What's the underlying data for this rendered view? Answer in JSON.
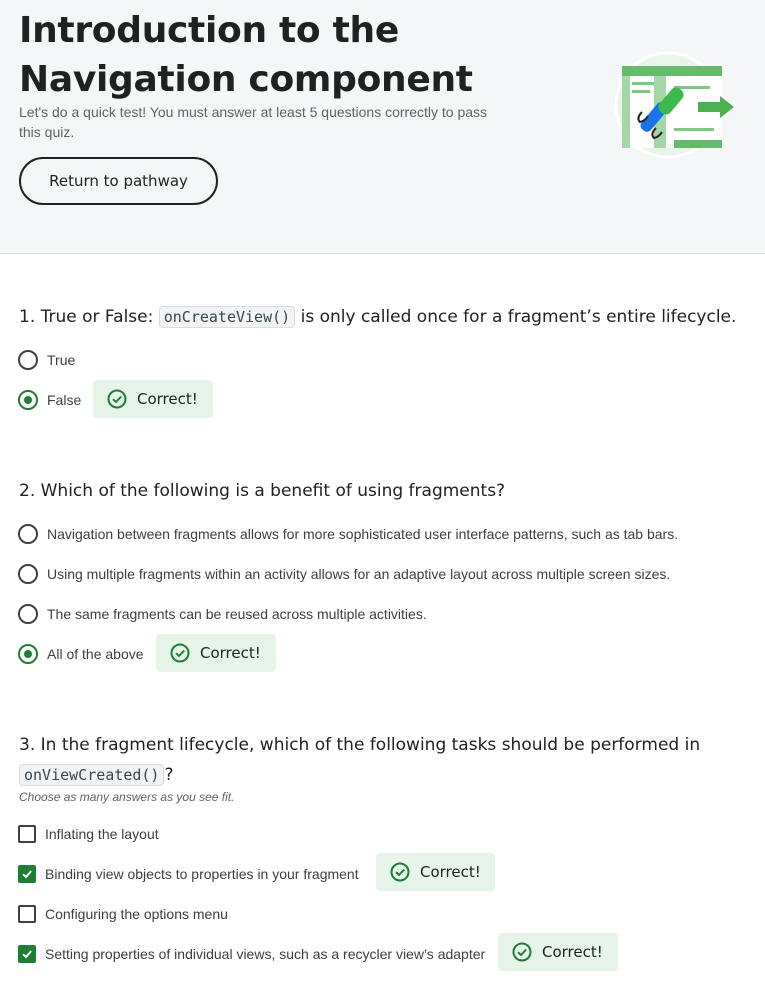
{
  "header": {
    "title": "Introduction to the Navigation component",
    "subtitle": "Let's do a quick test! You must answer at least 5 questions correctly to pass this quiz.",
    "return_button": "Return to pathway"
  },
  "colors": {
    "accent": "#1e7e34",
    "correct_bg": "#e6f4ea",
    "header_bg": "#f5f6f8"
  },
  "feedback": {
    "correct": "Correct!"
  },
  "q1": {
    "prefix": "1. True or False: ",
    "code": "onCreateView()",
    "suffix": " is only called once for a fragment’s entire lifecycle.",
    "options": [
      "True",
      "False"
    ]
  },
  "q2": {
    "text": "2. Which of the following is a benefit of using fragments?",
    "options": [
      "Navigation between fragments allows for more sophisticated user interface patterns, such as tab bars.",
      "Using multiple fragments within an activity allows for an adaptive layout across multiple screen sizes.",
      "The same fragments can be reused across multiple activities.",
      "All of the above"
    ]
  },
  "q3": {
    "prefix": "3. In the fragment lifecycle, which of the following tasks should be performed in",
    "code": "onViewCreated()",
    "suffix": "?",
    "hint": "Choose as many answers as you see fit.",
    "options": [
      "Inflating the layout",
      "Binding view objects to properties in your fragment",
      "Configuring the options menu",
      "Setting properties of individual views, such as a recycler view’s adapter"
    ]
  }
}
